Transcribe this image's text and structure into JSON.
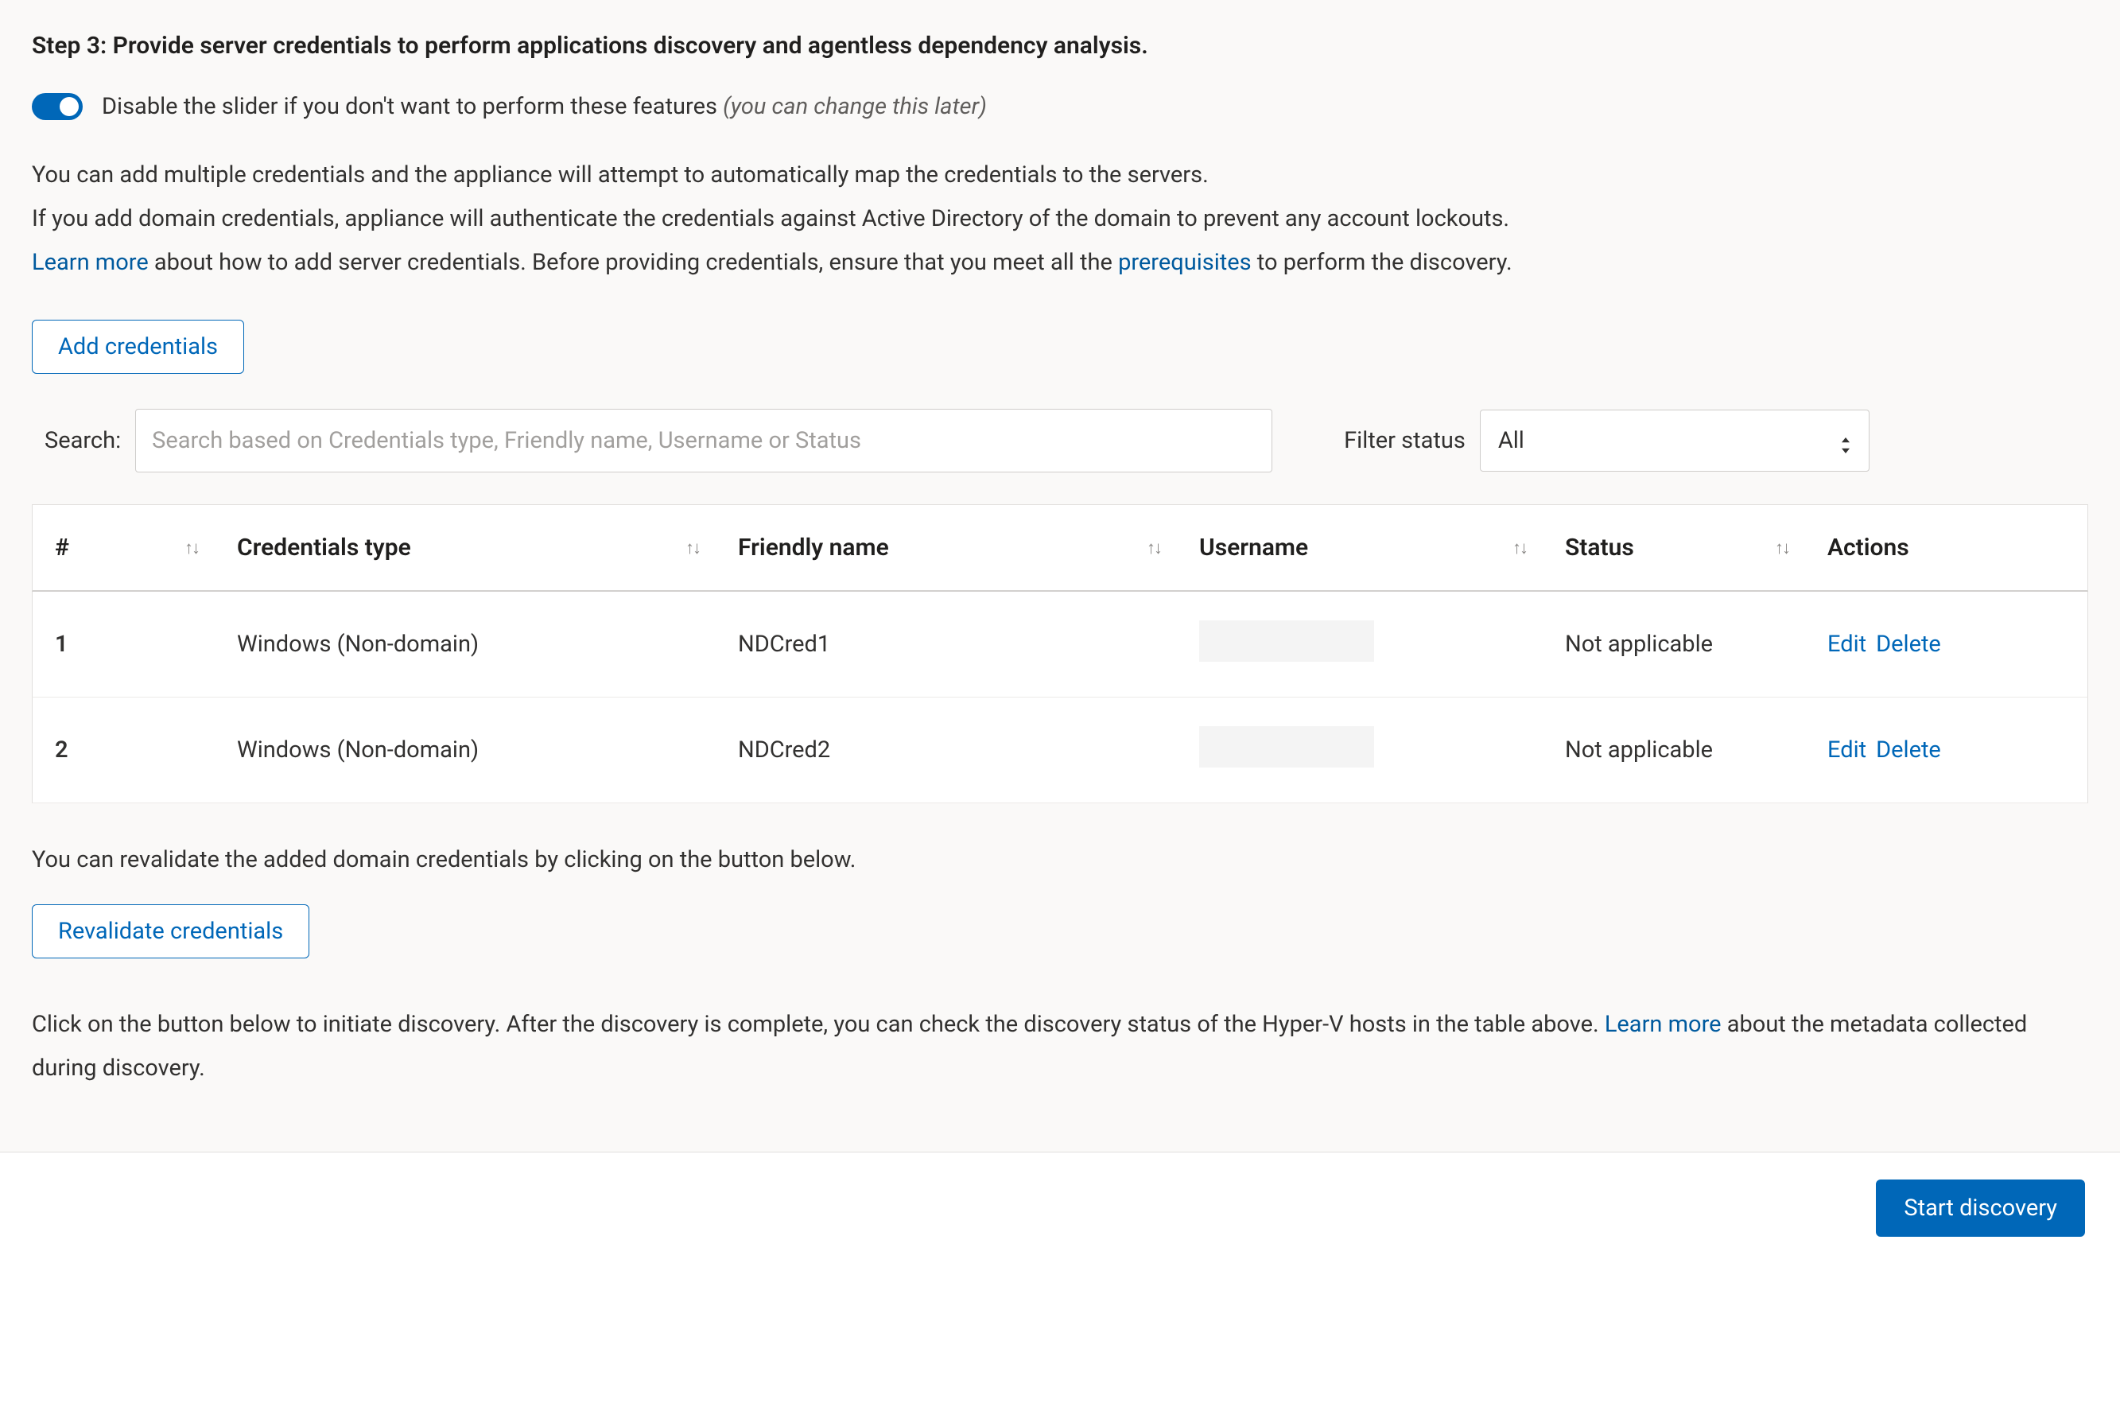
{
  "step": {
    "title": "Step 3: Provide server credentials to perform applications discovery and agentless dependency analysis."
  },
  "toggle": {
    "label_main": "Disable the slider if you don't want to perform these features ",
    "label_hint": "(you can change this later)"
  },
  "desc": {
    "line1": "You can add multiple credentials and the appliance will attempt to automatically map the credentials to the servers.",
    "line2": "If you add domain credentials, appliance will authenticate the credentials against Active Directory of the domain to prevent any account lockouts.",
    "learn_more": "Learn more",
    "line3_a": " about how to add server credentials. Before providing credentials, ensure that you meet all the ",
    "prerequisites": "prerequisites",
    "line3_b": " to perform the discovery."
  },
  "buttons": {
    "add_credentials": "Add credentials",
    "revalidate": "Revalidate credentials",
    "start_discovery": "Start discovery"
  },
  "search": {
    "label": "Search:",
    "placeholder": "Search based on Credentials type, Friendly name, Username or Status",
    "filter_label": "Filter status",
    "filter_value": "All"
  },
  "table": {
    "headers": {
      "idx": "#",
      "type": "Credentials type",
      "friendly": "Friendly name",
      "username": "Username",
      "status": "Status",
      "actions": "Actions"
    },
    "rows": [
      {
        "idx": "1",
        "type": "Windows (Non-domain)",
        "friendly": "NDCred1",
        "username": "",
        "status": "Not applicable"
      },
      {
        "idx": "2",
        "type": "Windows (Non-domain)",
        "friendly": "NDCred2",
        "username": "",
        "status": "Not applicable"
      }
    ],
    "actions": {
      "edit": "Edit",
      "delete": "Delete"
    }
  },
  "post1": "You can revalidate the added domain credentials by clicking on the button below.",
  "post2_a": "Click on the button below to initiate discovery. After the discovery is complete, you can check the discovery status of the Hyper-V hosts in the table above. ",
  "post2_learn": "Learn more",
  "post2_b": " about the metadata collected during discovery."
}
